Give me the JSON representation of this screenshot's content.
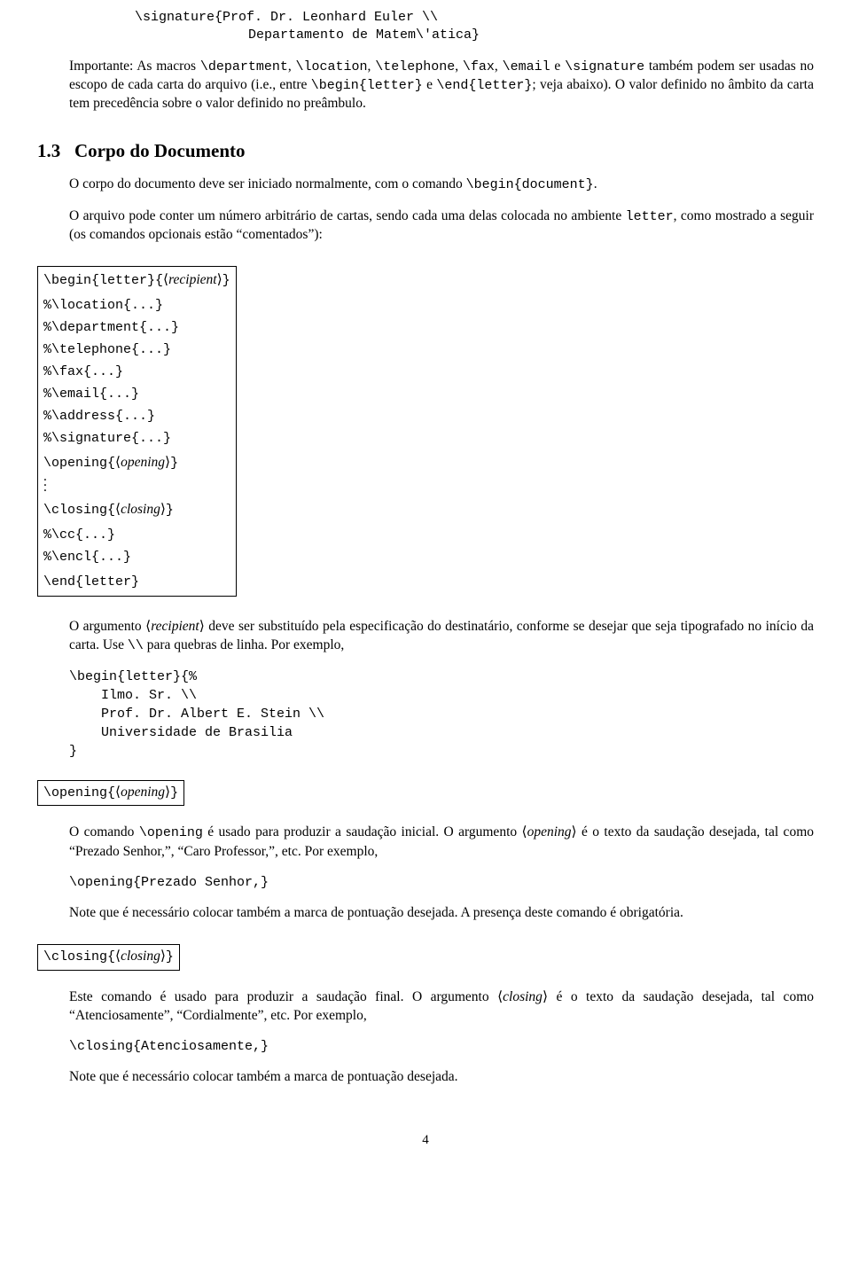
{
  "top_code": {
    "l1": "\\signature{Prof. Dr. Leonhard Euler \\\\",
    "l2": "Departamento de Matem\\'atica}"
  },
  "p1": {
    "t1": "Importante: As macros ",
    "c1": "\\department",
    "c2": "\\location",
    "c3": "\\telephone",
    "c4": "\\fax",
    "c5": "\\email",
    "t2": " e ",
    "c6": "\\signature",
    "t3": " também podem ser usadas no escopo de cada carta do arquivo (i.e., entre ",
    "c7": "\\begin{letter}",
    "t4": " e ",
    "c8": "\\end{letter}",
    "t5": "; veja abaixo). O valor definido no âmbito da carta tem precedência sobre o valor definido no preâmbulo."
  },
  "sec": {
    "num": "1.3",
    "title": "Corpo do Documento"
  },
  "p2": {
    "t1": "O corpo do documento deve ser iniciado normalmente, com o comando ",
    "c1": "\\begin{document}",
    "t2": "."
  },
  "p3": "O arquivo pode conter um número arbitrário de cartas, sendo cada uma delas colocada no ambiente letter, como mostrado a seguir (os comandos opcionais estão “comentados”):",
  "p3_tt": "letter",
  "box1": {
    "begin_cmd": "\\begin{letter}{",
    "recipient": "recipient",
    "close": "}",
    "loc": "%\\location{...}",
    "dep": "%\\department{...}",
    "tel": "%\\telephone{...}",
    "fax": "%\\fax{...}",
    "email": "%\\email{...}",
    "addr": "%\\address{...}",
    "sig": "%\\signature{...}",
    "open_cmd": "\\opening{",
    "opening": "opening",
    "dots": ".",
    "close_cmd": "\\closing{",
    "closing": "closing",
    "cc": "%\\cc{...}",
    "encl": "%\\encl{...}",
    "end": "\\end{letter}"
  },
  "p4": {
    "t1": "O argumento ",
    "arg": "recipient",
    "t2": " deve ser substituído pela especificação do destinatário, conforme se desejar que seja tipografado no início da carta. Use ",
    "c1": "\\\\",
    "t3": " para quebras de linha. Por exemplo,"
  },
  "code2": {
    "l1": "\\begin{letter}{%",
    "l2": "Ilmo. Sr. \\\\",
    "l3": "Prof. Dr. Albert E. Stein \\\\",
    "l4": "Universidade de Brasilia",
    "l5": "}"
  },
  "box2": {
    "cmd": "\\opening{",
    "arg": "opening",
    "close": "}"
  },
  "p5": {
    "t1": "O comando ",
    "c1": "\\opening",
    "t2": " é usado para produzir a saudação inicial. O argumento ",
    "arg": "opening",
    "t3": " é o texto da saudação desejada, tal como “Prezado Senhor,”, “Caro Professor,”, etc. Por exemplo,"
  },
  "code3": "\\opening{Prezado Senhor,}",
  "p6": "Note que é necessário colocar também a marca de pontuação desejada. A presença deste comando é obrigatória.",
  "box3": {
    "cmd": "\\closing{",
    "arg": "closing",
    "close": "}"
  },
  "p7": {
    "t1": "Este comando é usado para produzir a saudação final. O argumento ",
    "arg": "closing",
    "t2": " é o texto da saudação desejada, tal como “Atenciosamente”, “Cordialmente”, etc. Por exemplo,"
  },
  "code4": "\\closing{Atenciosamente,}",
  "p8": "Note que é necessário colocar também a marca de pontuação desejada.",
  "pagenum": "4"
}
